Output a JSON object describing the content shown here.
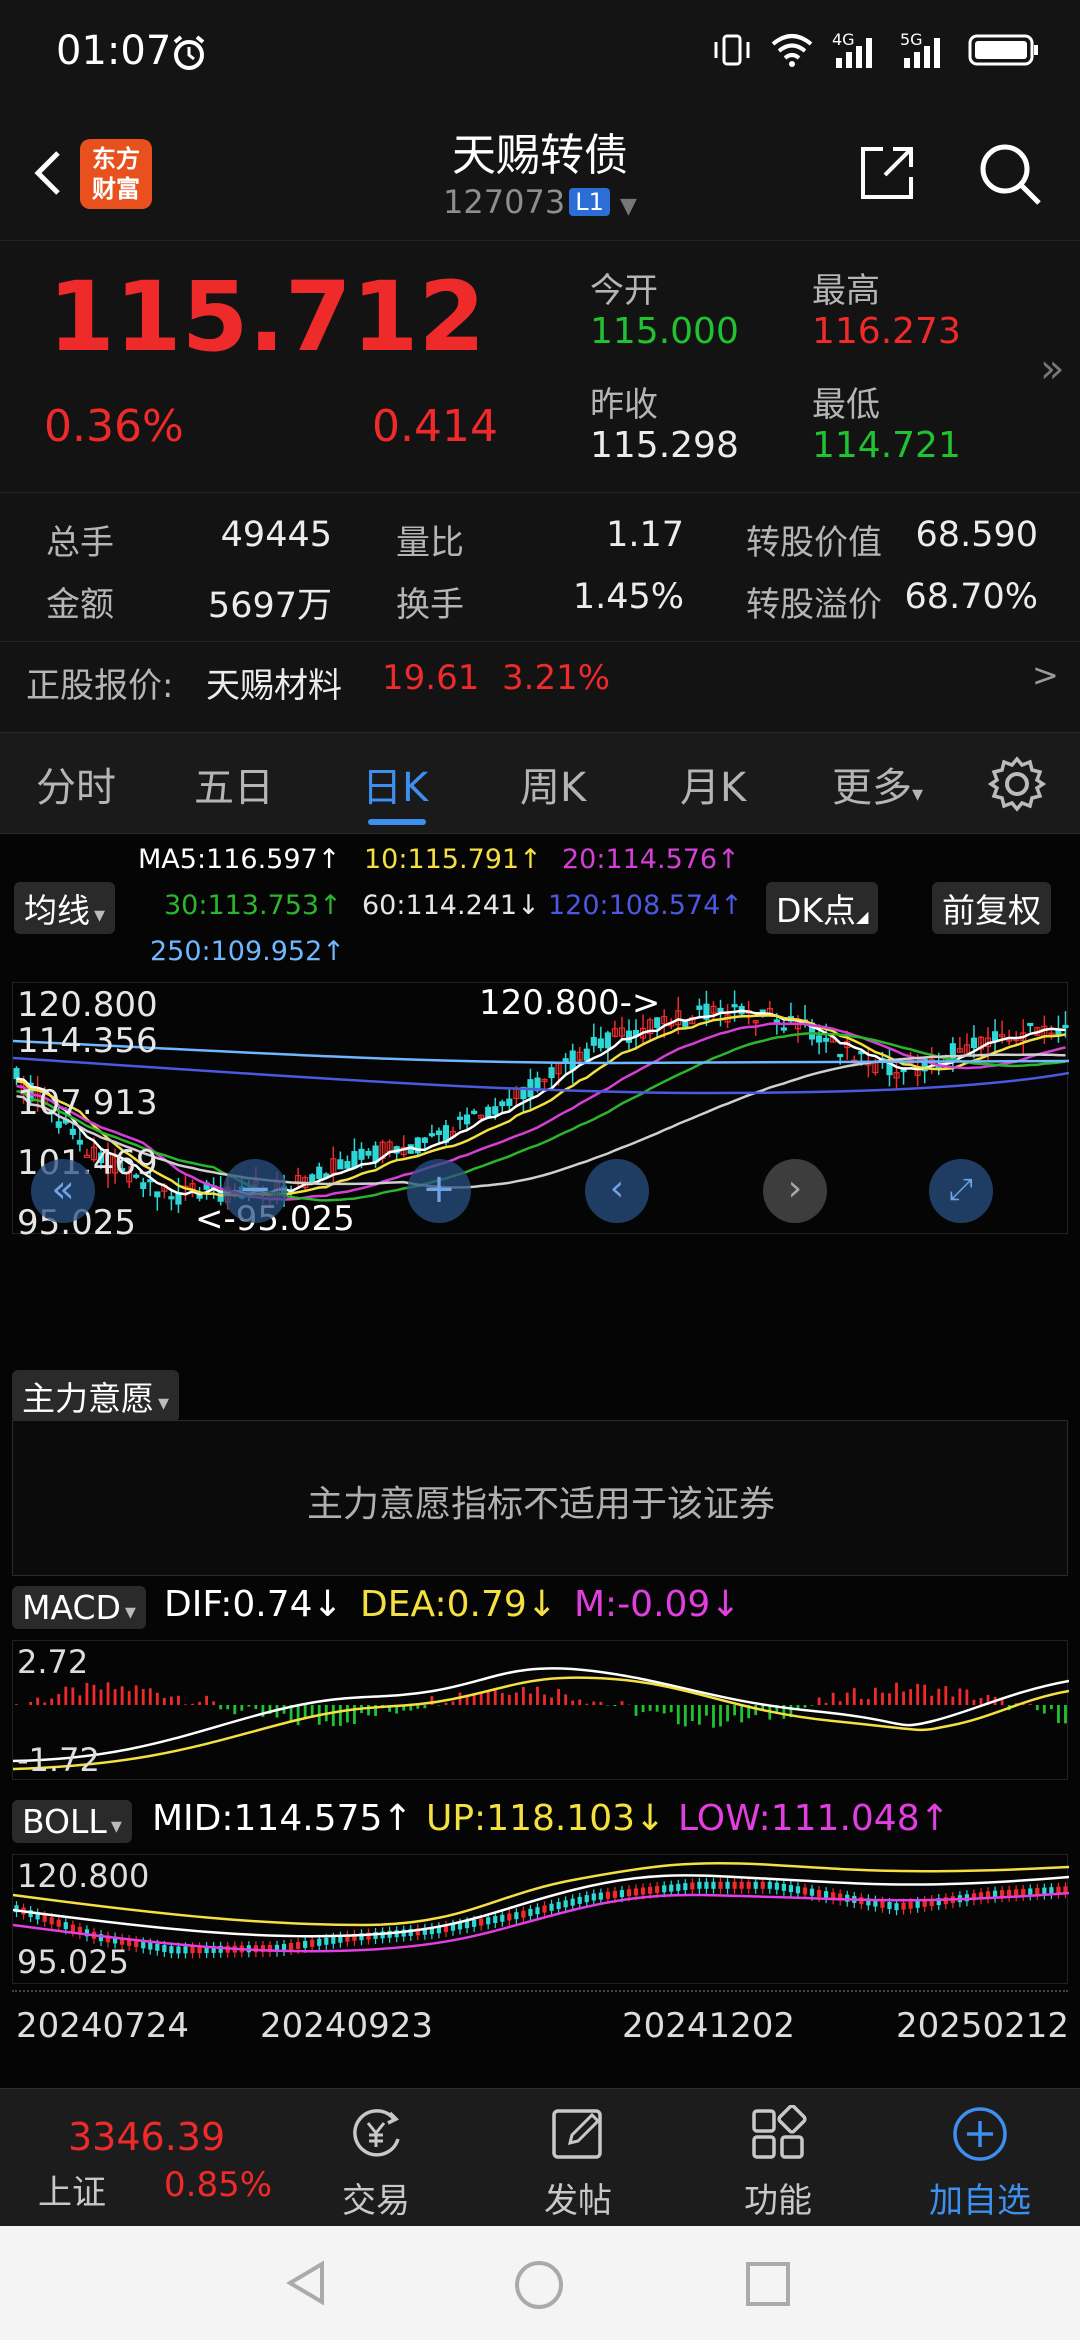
{
  "status_bar": {
    "time": "01:07",
    "signal_4g": "4G",
    "signal_5g": "5G"
  },
  "header": {
    "title": "天赐转债",
    "code": "127073",
    "level_badge": "L1",
    "logo_line1": "东方",
    "logo_line2": "财富"
  },
  "quote": {
    "price": "115.712",
    "change_pct": "0.36%",
    "change": "0.414",
    "open_label": "今开",
    "open": "115.000",
    "high_label": "最高",
    "high": "116.273",
    "prev_close_label": "昨收",
    "prev_close": "115.298",
    "low_label": "最低",
    "low": "114.721"
  },
  "stats": {
    "volume_label": "总手",
    "volume": "49445",
    "vol_ratio_label": "量比",
    "vol_ratio": "1.17",
    "conv_value_label": "转股价值",
    "conv_value": "68.590",
    "amount_label": "金额",
    "amount": "5697万",
    "turnover_label": "换手",
    "turnover": "1.45%",
    "conv_premium_label": "转股溢价",
    "conv_premium": "68.70%",
    "stock_label": "正股报价:",
    "stock_name": "天赐材料",
    "stock_price": "19.61",
    "stock_pct": "3.21%",
    "stock_chevron": ">"
  },
  "tabs": [
    "分时",
    "五日",
    "日K",
    "周K",
    "月K",
    "更多"
  ],
  "chart": {
    "ma_button": "均线",
    "dk_button": "DK点",
    "adjust_button": "前复权",
    "ma5": "MA5:116.597↑",
    "ma10": "10:115.791↑",
    "ma20": "20:114.576↑",
    "ma30": "30:113.753↑",
    "ma60": "60:114.241↓",
    "ma120": "120:108.574↑",
    "ma250": "250:109.952↑",
    "y_labels": [
      "120.800",
      "114.356",
      "107.913",
      "101.469",
      "95.025"
    ],
    "max_marker": "120.800->",
    "min_marker": "<-95.025",
    "main_force_button": "主力意愿",
    "main_force_msg": "主力意愿指标不适用于该证券",
    "macd_button": "MACD",
    "dif": "DIF:0.74↓",
    "dea": "DEA:0.79↓",
    "m": "M:-0.09↓",
    "macd_top": "2.72",
    "macd_bottom": "-1.72",
    "boll_button": "BOLL",
    "boll_mid": "MID:114.575↑",
    "boll_up": "UP:118.103↓",
    "boll_low": "LOW:111.048↑",
    "boll_top": "120.800",
    "boll_bottom": "95.025",
    "dates": [
      "20240724",
      "20240923",
      "20241202",
      "20250212"
    ],
    "colors": {
      "up": "#ee2a2a",
      "down": "#2fd6d6",
      "ma5": "#ffffff",
      "ma10": "#f5e042",
      "ma20": "#d63fd6",
      "ma30": "#2db52d",
      "ma60": "#cfcfcf",
      "ma120": "#4b58e0",
      "ma250": "#6fb8ff"
    }
  },
  "bottom": {
    "index_value": "3346.39",
    "index_name": "上证",
    "index_pct": "0.85%",
    "trade": "交易",
    "post": "发帖",
    "func": "功能",
    "add": "加自选"
  }
}
